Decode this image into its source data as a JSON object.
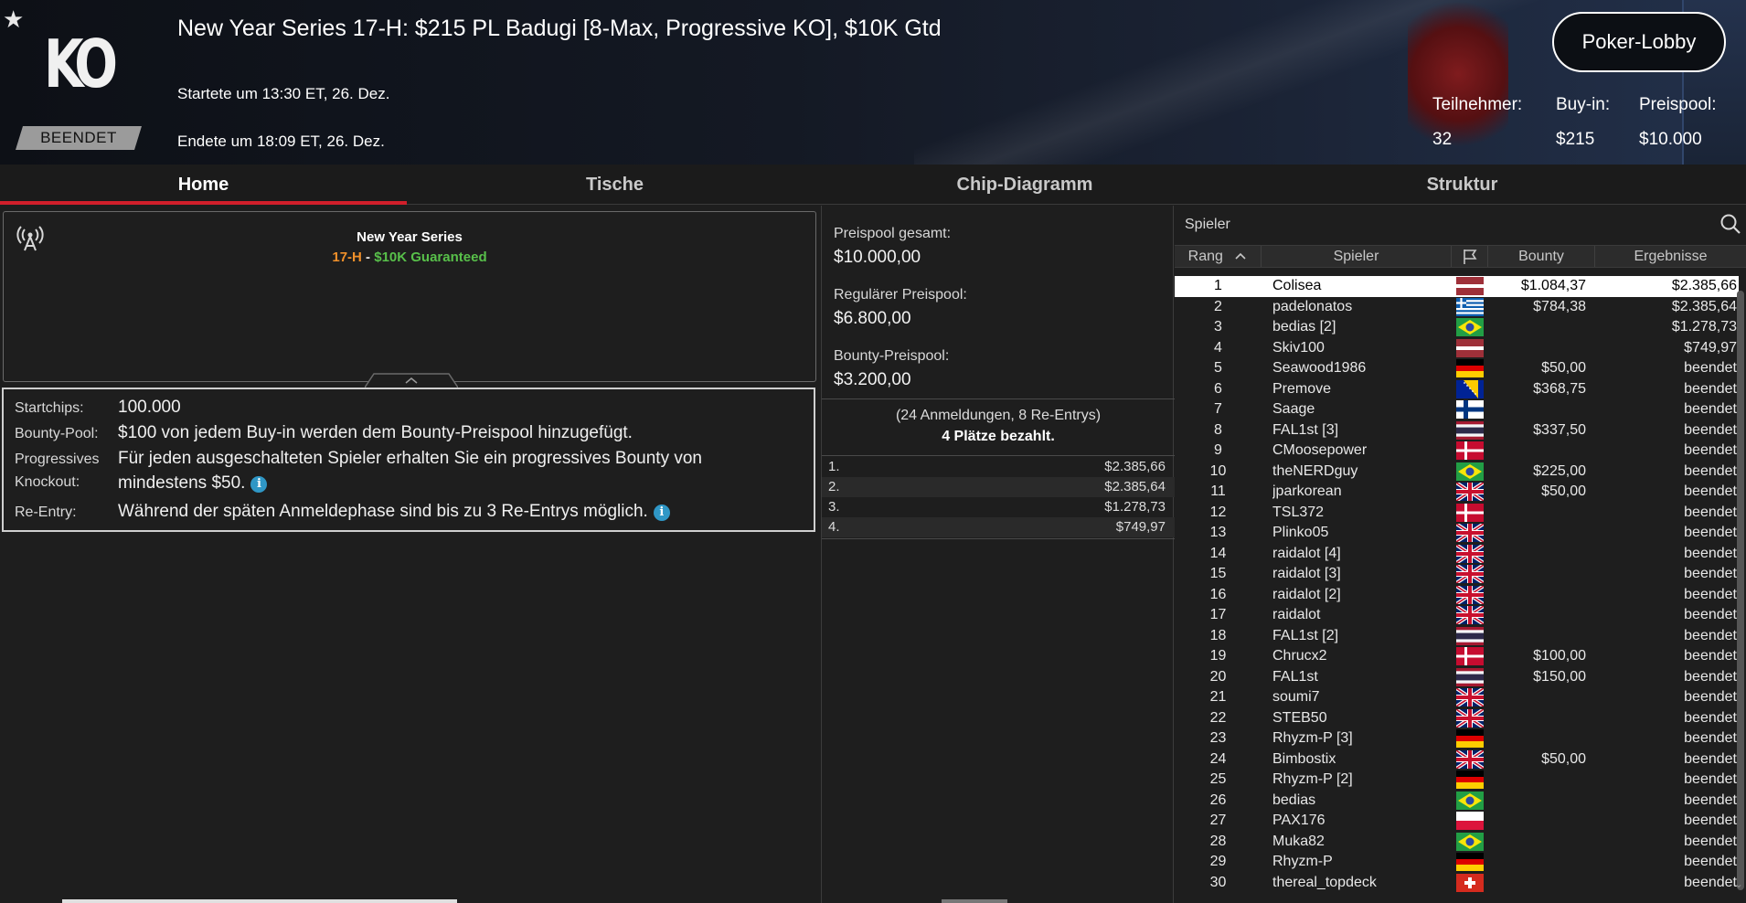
{
  "header": {
    "title": "New Year Series 17-H: $215 PL Badugi [8-Max, Progressive KO], $10K Gtd",
    "started": "Startete um 13:30 ET, 26. Dez.",
    "ended": "Endete um 18:09 ET, 26. Dez.",
    "logo_text": "KO",
    "status": "BEENDET",
    "lobby_button": "Poker-Lobby",
    "stats": [
      {
        "label": "Teilnehmer:",
        "value": "32"
      },
      {
        "label": "Buy-in:",
        "value": "$215"
      },
      {
        "label": "Preispool:",
        "value": "$10.000"
      }
    ]
  },
  "tabs": [
    {
      "label": "Home",
      "active": true
    },
    {
      "label": "Tische",
      "active": false
    },
    {
      "label": "Chip-Diagramm",
      "active": false
    },
    {
      "label": "Struktur",
      "active": false
    }
  ],
  "series": {
    "name": "New Year Series",
    "event_code": "17-H",
    "separator": " - ",
    "guarantee": "$10K Guaranteed"
  },
  "info": {
    "startchips_label": "Startchips:",
    "startchips_value": "100.000",
    "bounty_label": "Bounty-Pool:",
    "bounty_value": "$100 von jedem Buy-in werden dem Bounty-Preispool hinzugefügt.",
    "pko_label_1": "Progressives",
    "pko_label_2": "Knockout:",
    "pko_value_1": "Für jeden ausgeschalteten Spieler erhalten Sie ein progressives Bounty von",
    "pko_value_2": "mindestens $50.",
    "reentry_label": "Re-Entry:",
    "reentry_value": "Während der späten Anmeldephase sind bis zu 3 Re-Entrys möglich.",
    "info_glyph": "i"
  },
  "prizepool": {
    "total_label": "Preispool gesamt:",
    "total_value": "$10.000,00",
    "regular_label": "Regulärer Preispool:",
    "regular_value": "$6.800,00",
    "bounty_label": "Bounty-Preispool:",
    "bounty_value": "$3.200,00",
    "entries_text": "(24 Anmeldungen, 8 Re-Entrys)",
    "paid_text": "4 Plätze bezahlt.",
    "payouts": [
      {
        "place": "1.",
        "amount": "$2.385,66"
      },
      {
        "place": "2.",
        "amount": "$2.385,64"
      },
      {
        "place": "3.",
        "amount": "$1.278,73"
      },
      {
        "place": "4.",
        "amount": "$749,97"
      }
    ]
  },
  "players": {
    "title": "Spieler",
    "columns": {
      "rank": "Rang",
      "player": "Spieler",
      "bounty": "Bounty",
      "result": "Ergebnisse"
    },
    "sort_glyph": "^",
    "rows": [
      {
        "rank": "1",
        "name": "Colisea",
        "flag": "latvia",
        "bounty": "$1.084,37",
        "result": "$2.385,66"
      },
      {
        "rank": "2",
        "name": "padelonatos",
        "flag": "greece",
        "bounty": "$784,38",
        "result": "$2.385,64"
      },
      {
        "rank": "3",
        "name": "bedias [2]",
        "flag": "brazil",
        "bounty": "",
        "result": "$1.278,73"
      },
      {
        "rank": "4",
        "name": "Skiv100",
        "flag": "latvia",
        "bounty": "",
        "result": "$749,97"
      },
      {
        "rank": "5",
        "name": "Seawood1986",
        "flag": "germany",
        "bounty": "$50,00",
        "result": "beendet"
      },
      {
        "rank": "6",
        "name": "Premove",
        "flag": "bosnia",
        "bounty": "$368,75",
        "result": "beendet"
      },
      {
        "rank": "7",
        "name": "Saage",
        "flag": "finland",
        "bounty": "",
        "result": "beendet"
      },
      {
        "rank": "8",
        "name": "FAL1st [3]",
        "flag": "thailand",
        "bounty": "$337,50",
        "result": "beendet"
      },
      {
        "rank": "9",
        "name": "CMoosepower",
        "flag": "denmark",
        "bounty": "",
        "result": "beendet"
      },
      {
        "rank": "10",
        "name": "theNERDguy",
        "flag": "brazil",
        "bounty": "$225,00",
        "result": "beendet"
      },
      {
        "rank": "11",
        "name": "jparkorean",
        "flag": "uk",
        "bounty": "$50,00",
        "result": "beendet"
      },
      {
        "rank": "12",
        "name": "TSL372",
        "flag": "denmark",
        "bounty": "",
        "result": "beendet"
      },
      {
        "rank": "13",
        "name": "Plinko05",
        "flag": "uk",
        "bounty": "",
        "result": "beendet"
      },
      {
        "rank": "14",
        "name": "raidalot [4]",
        "flag": "uk",
        "bounty": "",
        "result": "beendet"
      },
      {
        "rank": "15",
        "name": "raidalot [3]",
        "flag": "uk",
        "bounty": "",
        "result": "beendet"
      },
      {
        "rank": "16",
        "name": "raidalot [2]",
        "flag": "uk",
        "bounty": "",
        "result": "beendet"
      },
      {
        "rank": "17",
        "name": "raidalot",
        "flag": "uk",
        "bounty": "",
        "result": "beendet"
      },
      {
        "rank": "18",
        "name": "FAL1st [2]",
        "flag": "thailand",
        "bounty": "",
        "result": "beendet"
      },
      {
        "rank": "19",
        "name": "Chrucx2",
        "flag": "denmark",
        "bounty": "$100,00",
        "result": "beendet"
      },
      {
        "rank": "20",
        "name": "FAL1st",
        "flag": "thailand",
        "bounty": "$150,00",
        "result": "beendet"
      },
      {
        "rank": "21",
        "name": "soumi7",
        "flag": "uk",
        "bounty": "",
        "result": "beendet"
      },
      {
        "rank": "22",
        "name": "STEB50",
        "flag": "uk",
        "bounty": "",
        "result": "beendet"
      },
      {
        "rank": "23",
        "name": "Rhyzm-P [3]",
        "flag": "germany",
        "bounty": "",
        "result": "beendet"
      },
      {
        "rank": "24",
        "name": "Bimbostix",
        "flag": "uk",
        "bounty": "$50,00",
        "result": "beendet"
      },
      {
        "rank": "25",
        "name": "Rhyzm-P [2]",
        "flag": "germany",
        "bounty": "",
        "result": "beendet"
      },
      {
        "rank": "26",
        "name": "bedias",
        "flag": "brazil",
        "bounty": "",
        "result": "beendet"
      },
      {
        "rank": "27",
        "name": "PAX176",
        "flag": "poland",
        "bounty": "",
        "result": "beendet"
      },
      {
        "rank": "28",
        "name": "Muka82",
        "flag": "brazil",
        "bounty": "",
        "result": "beendet"
      },
      {
        "rank": "29",
        "name": "Rhyzm-P",
        "flag": "germany",
        "bounty": "",
        "result": "beendet"
      },
      {
        "rank": "30",
        "name": "thereal_topdeck",
        "flag": "switzerland",
        "bounty": "",
        "result": "beendet"
      }
    ]
  },
  "colors": {
    "accent_red": "#d11f2b",
    "orange": "#f0902a",
    "green": "#58c04a",
    "info_blue": "#2f97c6"
  }
}
